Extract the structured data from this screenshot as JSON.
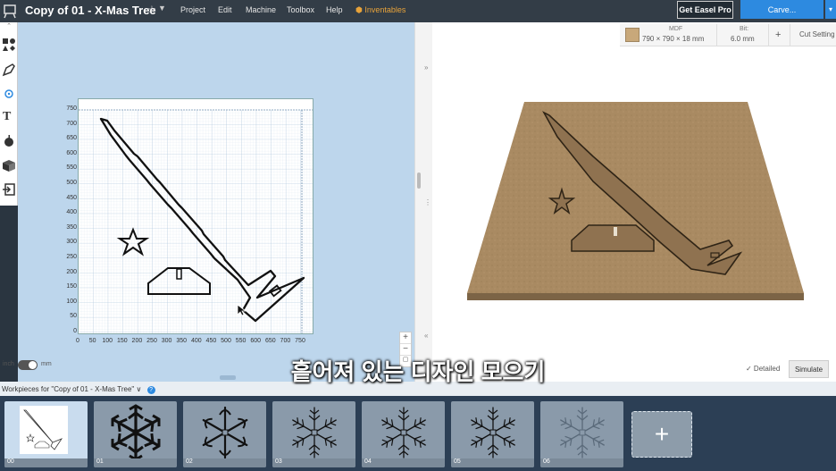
{
  "app": {
    "title": "Copy of 01 - X-Mas Tree",
    "star_icon": "star-outline-icon",
    "dropdown_icon": "chevron-down-icon"
  },
  "menu": {
    "project": "Project",
    "edit": "Edit",
    "machine": "Machine",
    "toolbox": "Toolbox",
    "help": "Help",
    "inventables": "Inventables"
  },
  "buttons": {
    "easel_pro": "Get Easel Pro",
    "carve": "Carve...",
    "simulate": "Simulate"
  },
  "material": {
    "type": "MDF",
    "size": "790 × 790 × 18 mm",
    "bit_label": "Bit:",
    "bit_value": "6.0 mm",
    "plus": "+",
    "cut_settings": "Cut Setting",
    "swatch_color": "#c8a87a"
  },
  "units": {
    "inch": "inch",
    "mm": "mm"
  },
  "grid": {
    "y_ticks": [
      "750",
      "700",
      "650",
      "600",
      "550",
      "500",
      "450",
      "400",
      "350",
      "300",
      "250",
      "200",
      "150",
      "100",
      "50",
      "0"
    ],
    "x_ticks": [
      "0",
      "50",
      "100",
      "150",
      "200",
      "250",
      "300",
      "350",
      "400",
      "450",
      "500",
      "550",
      "600",
      "650",
      "700",
      "750"
    ]
  },
  "zoom": {
    "plus": "+",
    "minus": "−"
  },
  "preview": {
    "detailed": "✓ Detailed"
  },
  "workpieces": {
    "label": "Workpieces for \"Copy of 01 - X-Mas Tree\" ∨",
    "help": "?",
    "items": [
      {
        "label": "00"
      },
      {
        "label": "01"
      },
      {
        "label": "02"
      },
      {
        "label": "03"
      },
      {
        "label": "04"
      },
      {
        "label": "05"
      },
      {
        "label": "06"
      }
    ],
    "add": "+"
  },
  "subtitle": "흩어져 있는 디자인 모으기",
  "colors": {
    "accent": "#2d8ae0",
    "topbar": "#333d47",
    "canvas_bg": "#bdd6ec",
    "board": "#a98a62"
  }
}
